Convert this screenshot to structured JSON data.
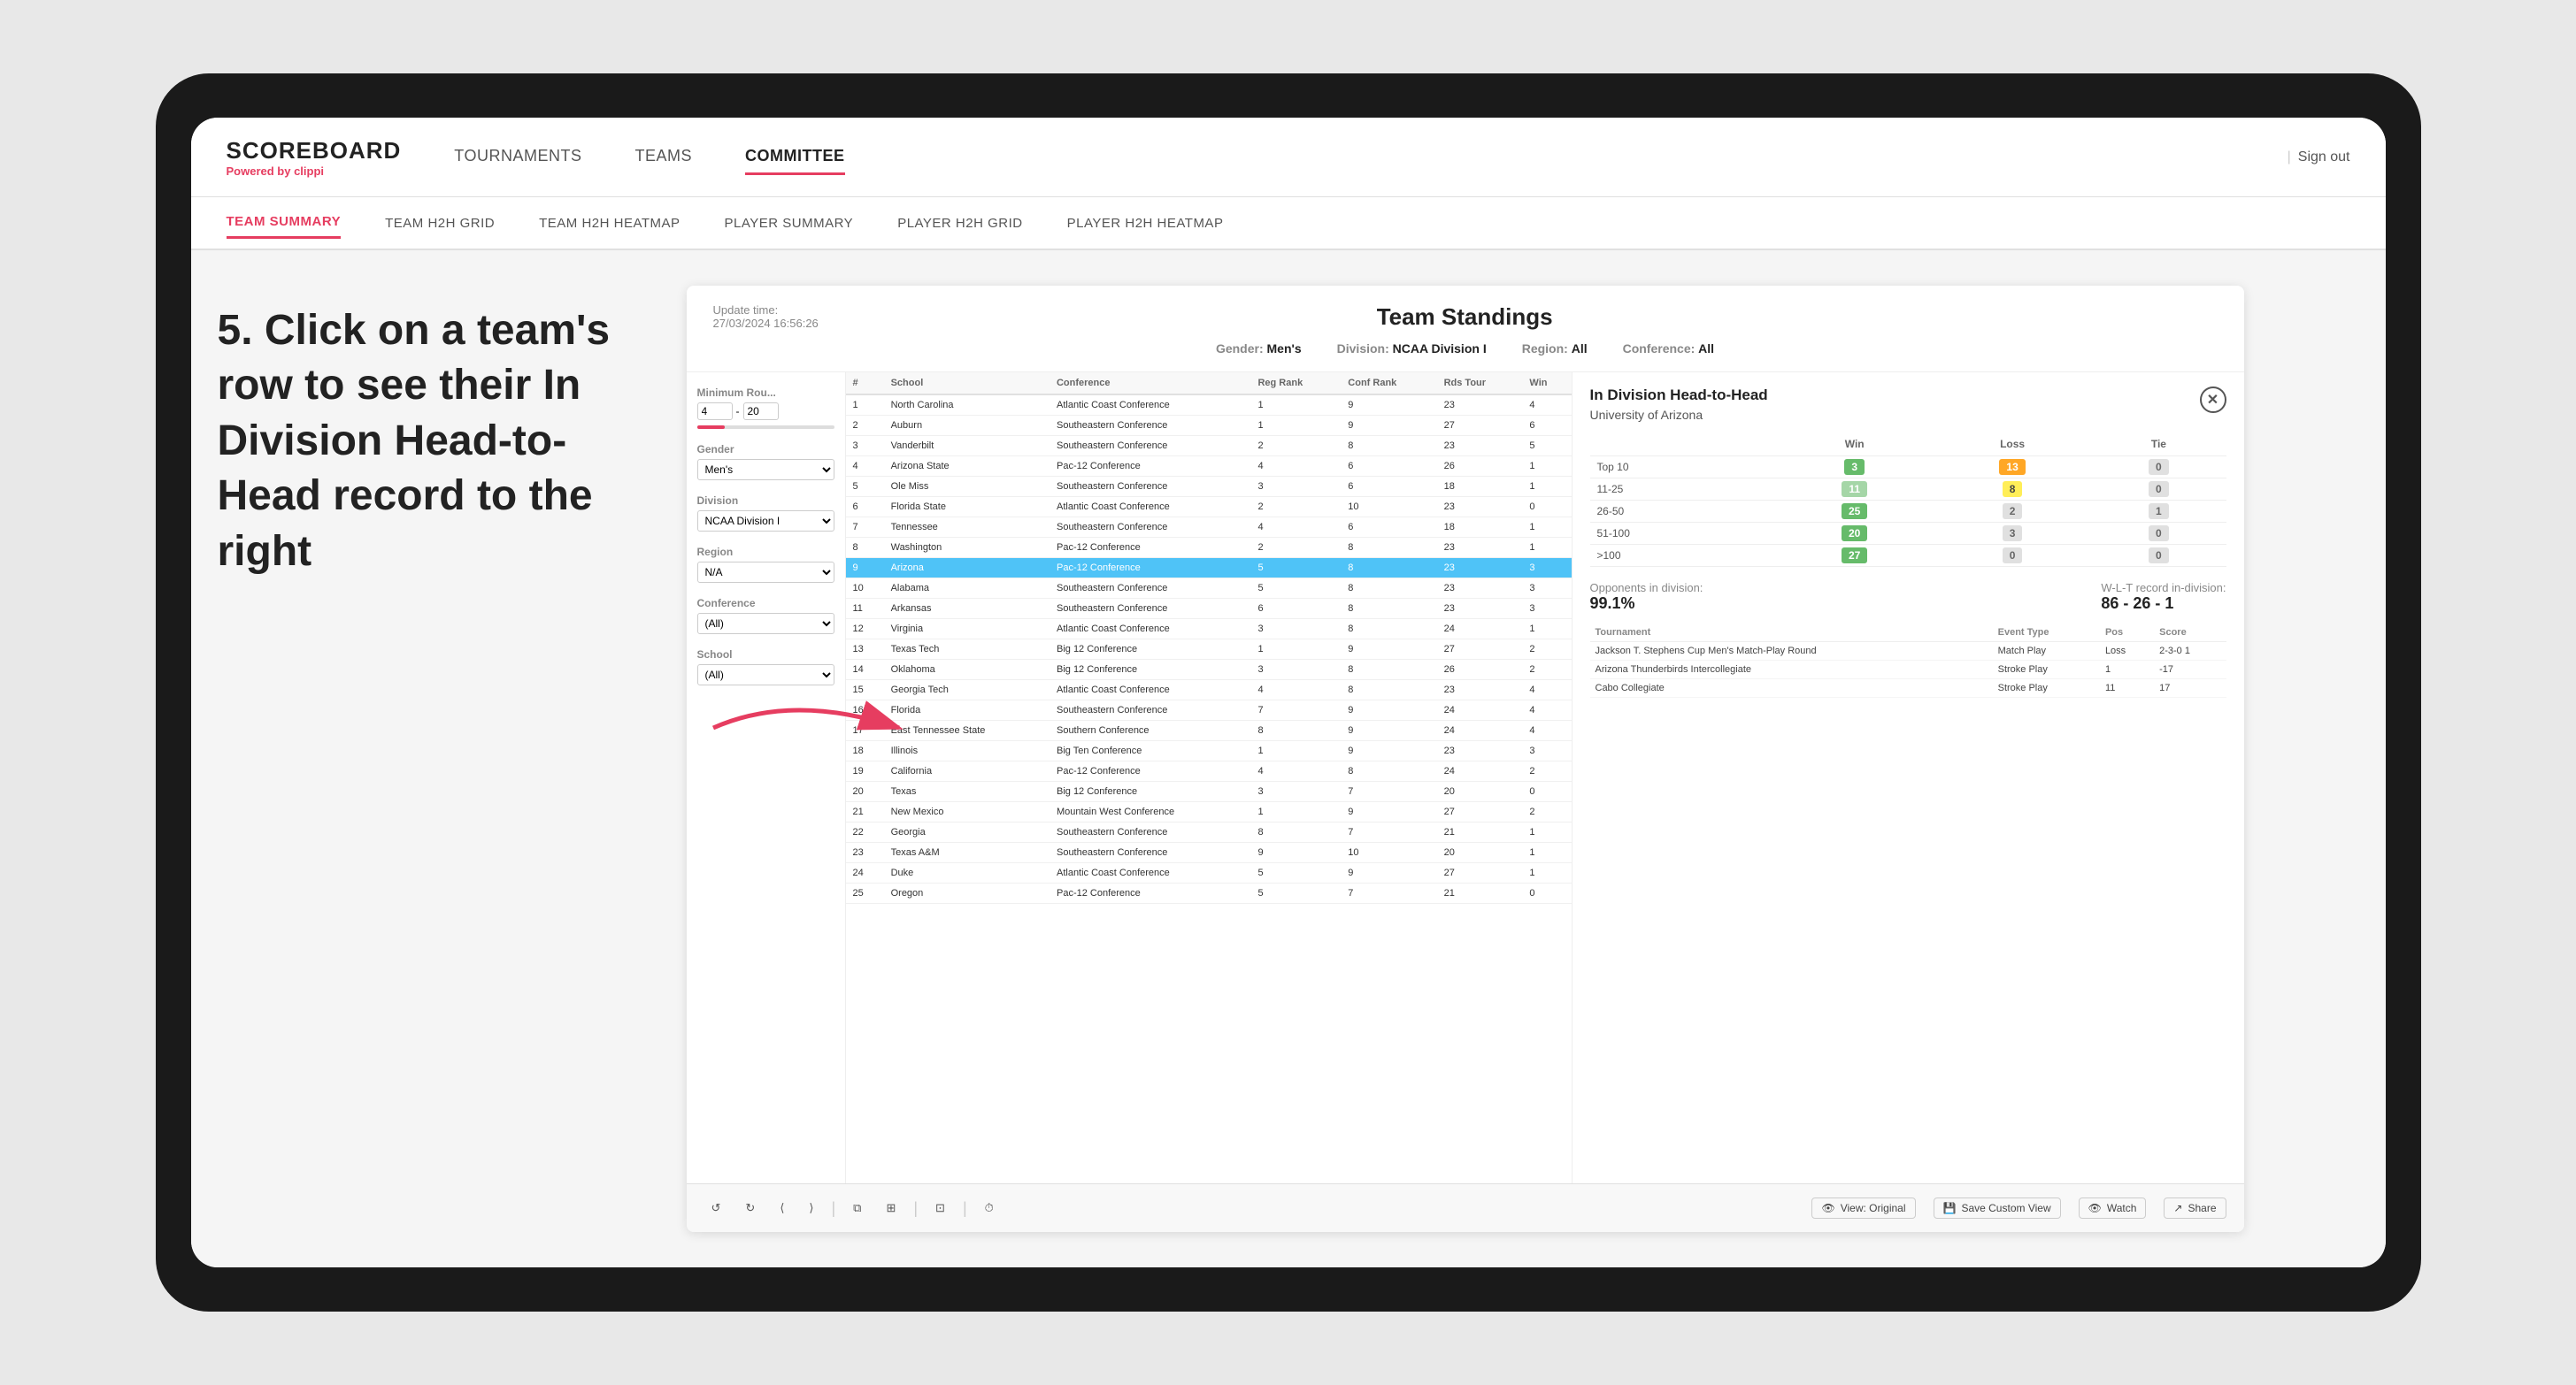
{
  "device": {
    "background": "#1a1a1a"
  },
  "nav": {
    "logo": "SCOREBOARD",
    "logo_sub_prefix": "Powered by ",
    "logo_sub_brand": "clippi",
    "items": [
      "TOURNAMENTS",
      "TEAMS",
      "COMMITTEE"
    ],
    "active_item": "COMMITTEE",
    "sign_out": "Sign out"
  },
  "sub_nav": {
    "items": [
      "TEAM SUMMARY",
      "TEAM H2H GRID",
      "TEAM H2H HEATMAP",
      "PLAYER SUMMARY",
      "PLAYER H2H GRID",
      "PLAYER H2H HEATMAP"
    ],
    "active_item": "PLAYER SUMMARY"
  },
  "instruction": {
    "text": "5. Click on a team's row to see their In Division Head-to-Head record to the right"
  },
  "panel": {
    "update_label": "Update time:",
    "update_time": "27/03/2024 16:56:26",
    "title": "Team Standings",
    "gender_label": "Gender:",
    "gender_value": "Men's",
    "division_label": "Division:",
    "division_value": "NCAA Division I",
    "region_label": "Region:",
    "region_value": "All",
    "conference_label": "Conference:",
    "conference_value": "All"
  },
  "filters": {
    "min_rounds_label": "Minimum Rou...",
    "min_rounds_value": "4",
    "min_rounds_max": "20",
    "gender_label": "Gender",
    "gender_value": "Men's",
    "division_label": "Division",
    "division_value": "NCAA Division I",
    "region_label": "Region",
    "region_value": "N/A",
    "conference_label": "Conference",
    "conference_value": "(All)",
    "school_label": "School",
    "school_value": "(All)"
  },
  "table": {
    "columns": [
      "#",
      "School",
      "Conference",
      "Reg Rank",
      "Conf Rank",
      "Rds Tour",
      "Win"
    ],
    "rows": [
      {
        "rank": 1,
        "school": "North Carolina",
        "conference": "Atlantic Coast Conference",
        "reg_rank": 1,
        "conf_rank": 9,
        "rds": 23,
        "win": 4,
        "highlighted": false
      },
      {
        "rank": 2,
        "school": "Auburn",
        "conference": "Southeastern Conference",
        "reg_rank": 1,
        "conf_rank": 9,
        "rds": 27,
        "win": 6,
        "highlighted": false
      },
      {
        "rank": 3,
        "school": "Vanderbilt",
        "conference": "Southeastern Conference",
        "reg_rank": 2,
        "conf_rank": 8,
        "rds": 23,
        "win": 5,
        "highlighted": false
      },
      {
        "rank": 4,
        "school": "Arizona State",
        "conference": "Pac-12 Conference",
        "reg_rank": 4,
        "conf_rank": 6,
        "rds": 26,
        "win": 1,
        "highlighted": false
      },
      {
        "rank": 5,
        "school": "Ole Miss",
        "conference": "Southeastern Conference",
        "reg_rank": 3,
        "conf_rank": 6,
        "rds": 18,
        "win": 1,
        "highlighted": false
      },
      {
        "rank": 6,
        "school": "Florida State",
        "conference": "Atlantic Coast Conference",
        "reg_rank": 2,
        "conf_rank": 10,
        "rds": 23,
        "win": 0,
        "highlighted": false
      },
      {
        "rank": 7,
        "school": "Tennessee",
        "conference": "Southeastern Conference",
        "reg_rank": 4,
        "conf_rank": 6,
        "rds": 18,
        "win": 1,
        "highlighted": false
      },
      {
        "rank": 8,
        "school": "Washington",
        "conference": "Pac-12 Conference",
        "reg_rank": 2,
        "conf_rank": 8,
        "rds": 23,
        "win": 1,
        "highlighted": false
      },
      {
        "rank": 9,
        "school": "Arizona",
        "conference": "Pac-12 Conference",
        "reg_rank": 5,
        "conf_rank": 8,
        "rds": 23,
        "win": 3,
        "highlighted": true
      },
      {
        "rank": 10,
        "school": "Alabama",
        "conference": "Southeastern Conference",
        "reg_rank": 5,
        "conf_rank": 8,
        "rds": 23,
        "win": 3,
        "highlighted": false
      },
      {
        "rank": 11,
        "school": "Arkansas",
        "conference": "Southeastern Conference",
        "reg_rank": 6,
        "conf_rank": 8,
        "rds": 23,
        "win": 3,
        "highlighted": false
      },
      {
        "rank": 12,
        "school": "Virginia",
        "conference": "Atlantic Coast Conference",
        "reg_rank": 3,
        "conf_rank": 8,
        "rds": 24,
        "win": 1,
        "highlighted": false
      },
      {
        "rank": 13,
        "school": "Texas Tech",
        "conference": "Big 12 Conference",
        "reg_rank": 1,
        "conf_rank": 9,
        "rds": 27,
        "win": 2,
        "highlighted": false
      },
      {
        "rank": 14,
        "school": "Oklahoma",
        "conference": "Big 12 Conference",
        "reg_rank": 3,
        "conf_rank": 8,
        "rds": 26,
        "win": 2,
        "highlighted": false
      },
      {
        "rank": 15,
        "school": "Georgia Tech",
        "conference": "Atlantic Coast Conference",
        "reg_rank": 4,
        "conf_rank": 8,
        "rds": 23,
        "win": 4,
        "highlighted": false
      },
      {
        "rank": 16,
        "school": "Florida",
        "conference": "Southeastern Conference",
        "reg_rank": 7,
        "conf_rank": 9,
        "rds": 24,
        "win": 4,
        "highlighted": false
      },
      {
        "rank": 17,
        "school": "East Tennessee State",
        "conference": "Southern Conference",
        "reg_rank": 8,
        "conf_rank": 9,
        "rds": 24,
        "win": 4,
        "highlighted": false
      },
      {
        "rank": 18,
        "school": "Illinois",
        "conference": "Big Ten Conference",
        "reg_rank": 1,
        "conf_rank": 9,
        "rds": 23,
        "win": 3,
        "highlighted": false
      },
      {
        "rank": 19,
        "school": "California",
        "conference": "Pac-12 Conference",
        "reg_rank": 4,
        "conf_rank": 8,
        "rds": 24,
        "win": 2,
        "highlighted": false
      },
      {
        "rank": 20,
        "school": "Texas",
        "conference": "Big 12 Conference",
        "reg_rank": 3,
        "conf_rank": 7,
        "rds": 20,
        "win": 0,
        "highlighted": false
      },
      {
        "rank": 21,
        "school": "New Mexico",
        "conference": "Mountain West Conference",
        "reg_rank": 1,
        "conf_rank": 9,
        "rds": 27,
        "win": 2,
        "highlighted": false
      },
      {
        "rank": 22,
        "school": "Georgia",
        "conference": "Southeastern Conference",
        "reg_rank": 8,
        "conf_rank": 7,
        "rds": 21,
        "win": 1,
        "highlighted": false
      },
      {
        "rank": 23,
        "school": "Texas A&M",
        "conference": "Southeastern Conference",
        "reg_rank": 9,
        "conf_rank": 10,
        "rds": 20,
        "win": 1,
        "highlighted": false
      },
      {
        "rank": 24,
        "school": "Duke",
        "conference": "Atlantic Coast Conference",
        "reg_rank": 5,
        "conf_rank": 9,
        "rds": 27,
        "win": 1,
        "highlighted": false
      },
      {
        "rank": 25,
        "school": "Oregon",
        "conference": "Pac-12 Conference",
        "reg_rank": 5,
        "conf_rank": 7,
        "rds": 21,
        "win": 0,
        "highlighted": false
      }
    ]
  },
  "h2h": {
    "title": "In Division Head-to-Head",
    "team": "University of Arizona",
    "columns": [
      "",
      "Win",
      "Loss",
      "Tie"
    ],
    "rows": [
      {
        "range": "Top 10",
        "win": 3,
        "loss": 13,
        "tie": 0,
        "win_color": "green",
        "loss_color": "orange"
      },
      {
        "range": "11-25",
        "win": 11,
        "loss": 8,
        "tie": 0,
        "win_color": "lightgreen",
        "loss_color": "yellow"
      },
      {
        "range": "26-50",
        "win": 25,
        "loss": 2,
        "tie": 1,
        "win_color": "green",
        "loss_color": "gray"
      },
      {
        "range": "51-100",
        "win": 20,
        "loss": 3,
        "tie": 0,
        "win_color": "green",
        "loss_color": "gray"
      },
      {
        "range": ">100",
        "win": 27,
        "loss": 0,
        "tie": 0,
        "win_color": "green",
        "loss_color": "gray"
      }
    ],
    "opponents_label": "Opponents in division:",
    "opponents_value": "99.1%",
    "wlt_label": "W-L-T record in-division:",
    "wlt_value": "86 - 26 - 1",
    "tournaments_label": "Tournament",
    "tournaments_columns": [
      "Tournament",
      "Event Type",
      "Pos",
      "Score"
    ],
    "tournaments": [
      {
        "name": "Jackson T. Stephens Cup Men's Match-Play Round",
        "event_type": "Match Play",
        "pos": "Loss",
        "score": "2-3-0 1"
      },
      {
        "name": "Arizona Thunderbirds Intercollegiate",
        "event_type": "Stroke Play",
        "pos": "1",
        "score": "-17"
      },
      {
        "name": "Cabo Collegiate",
        "event_type": "Stroke Play",
        "pos": "11",
        "score": "17"
      }
    ]
  },
  "toolbar": {
    "undo": "↺",
    "redo": "↻",
    "step_back": "⟨",
    "step_forward": "⟩",
    "copy": "⧉",
    "paste": "⊞",
    "clock": "⏱",
    "view_original": "View: Original",
    "save_custom": "Save Custom View",
    "watch": "Watch",
    "share": "Share"
  }
}
